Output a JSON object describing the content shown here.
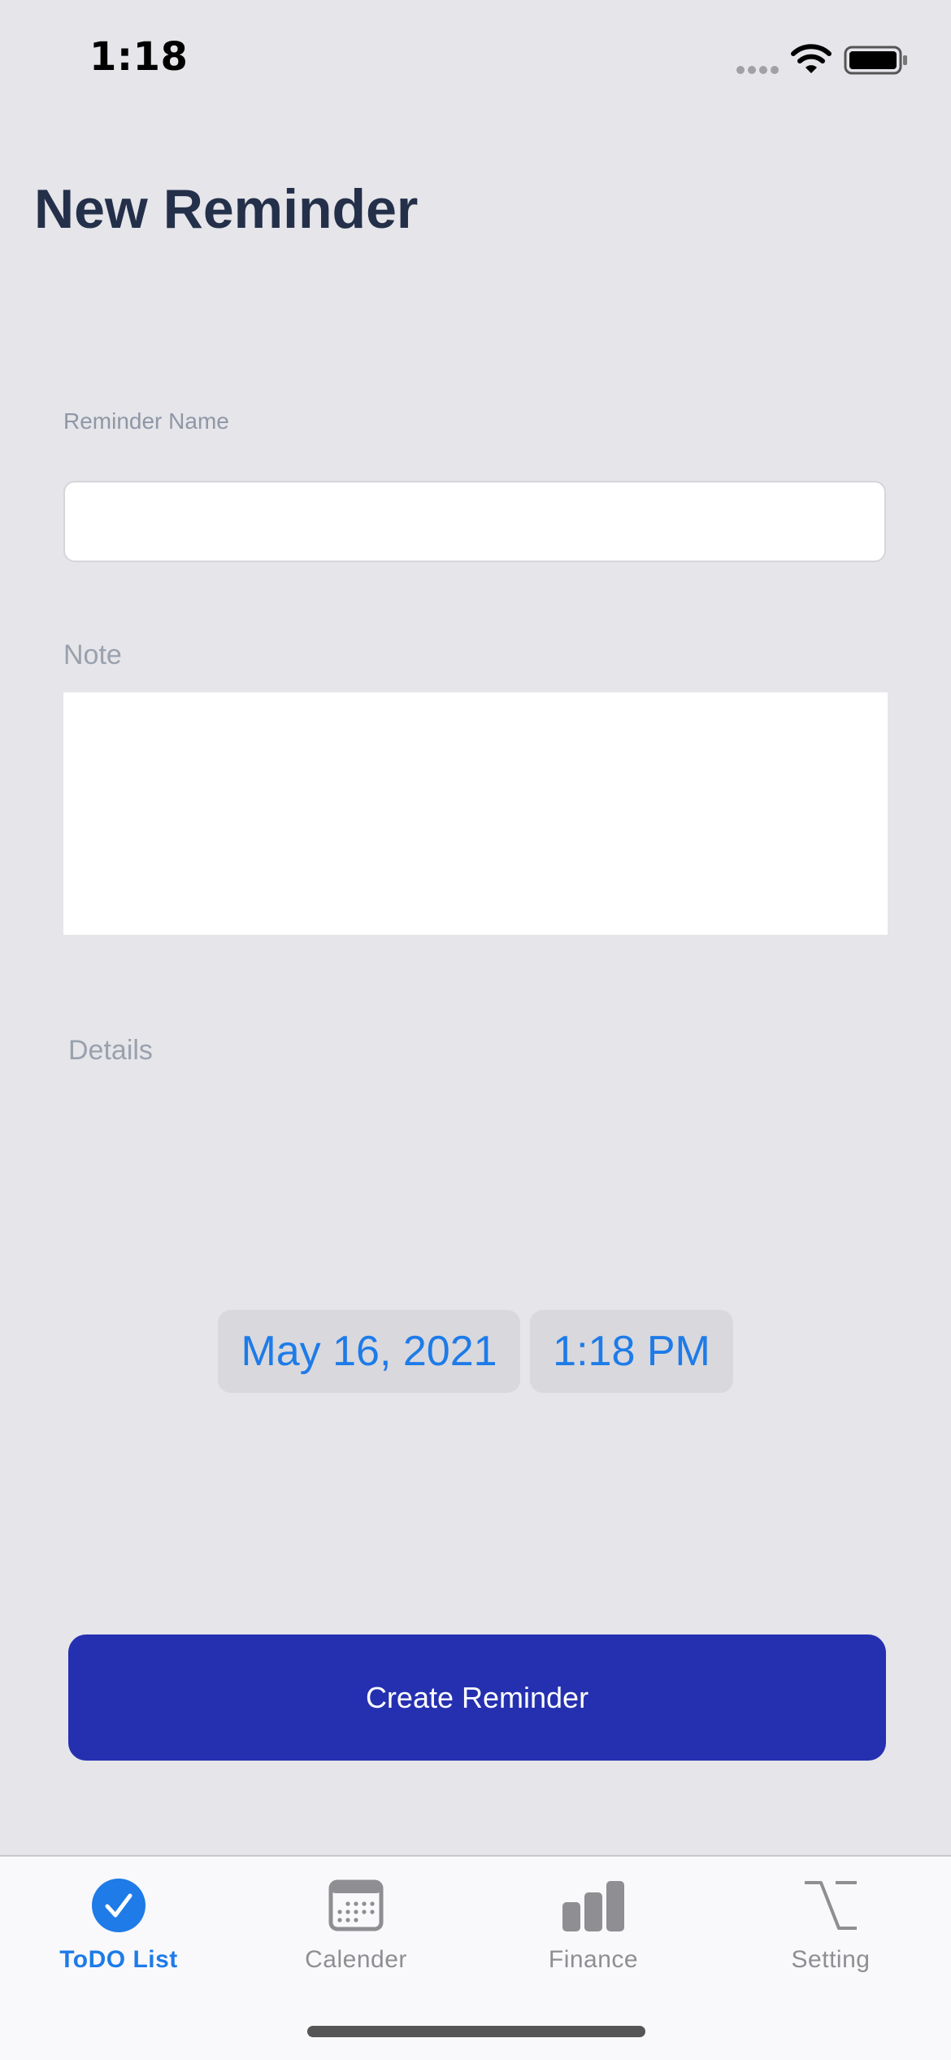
{
  "status_bar": {
    "time": "1:18"
  },
  "page": {
    "title": "New Reminder"
  },
  "form": {
    "name_label": "Reminder Name",
    "name_value": "",
    "note_label": "Note",
    "note_value": "",
    "details_label": "Details",
    "date_value": "May 16, 2021",
    "time_value": "1:18 PM",
    "submit_label": "Create Reminder"
  },
  "tab_bar": {
    "tabs": [
      {
        "label": "ToDO List",
        "icon": "checkmark-circle-icon",
        "active": true
      },
      {
        "label": "Calender",
        "icon": "calendar-icon",
        "active": false
      },
      {
        "label": "Finance",
        "icon": "bar-chart-icon",
        "active": false
      },
      {
        "label": "Setting",
        "icon": "option-key-icon",
        "active": false
      }
    ]
  },
  "colors": {
    "background": "#e5e5ea",
    "accent": "#1e7be8",
    "primary_button": "#2530b0",
    "title": "#243049"
  }
}
